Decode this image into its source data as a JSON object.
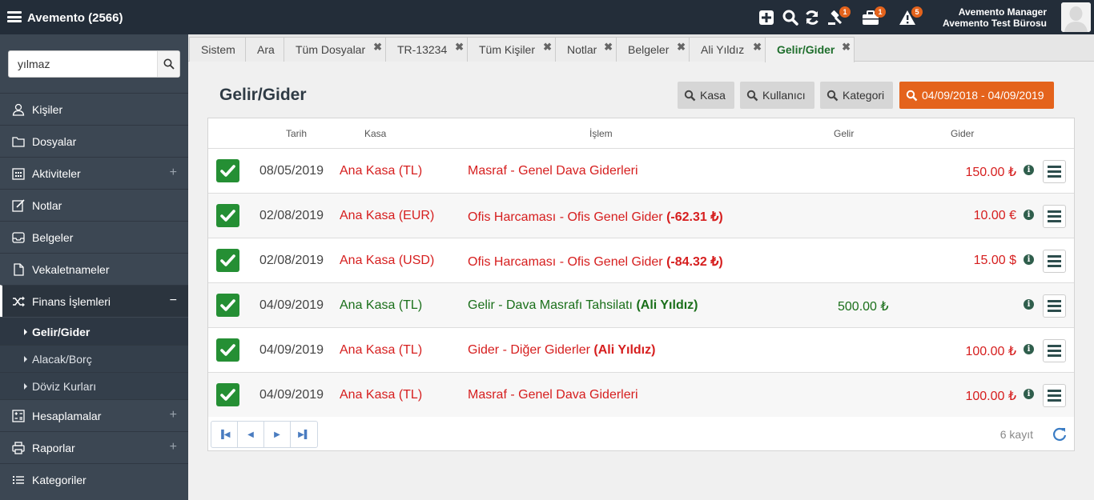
{
  "app": {
    "title": "Avemento (2566)"
  },
  "topbar": {
    "badges": {
      "gavel": "1",
      "briefcase": "1",
      "alert": "5"
    },
    "user_line1": "Avemento Manager",
    "user_line2": "Avemento Test Bürosu"
  },
  "sidebar": {
    "search_value": "yılmaz",
    "items": [
      {
        "label": "Kişiler",
        "icon": "person-icon",
        "plus": ""
      },
      {
        "label": "Dosyalar",
        "icon": "folder-icon",
        "plus": ""
      },
      {
        "label": "Aktiviteler",
        "icon": "calendar-icon",
        "plus": "+"
      },
      {
        "label": "Notlar",
        "icon": "edit-icon",
        "plus": ""
      },
      {
        "label": "Belgeler",
        "icon": "inbox-icon",
        "plus": ""
      },
      {
        "label": "Vekaletnameler",
        "icon": "file-icon",
        "plus": ""
      },
      {
        "label": "Finans İşlemleri",
        "icon": "shuffle-icon",
        "plus": "−"
      },
      {
        "label": "Hesaplamalar",
        "icon": "calculator-icon",
        "plus": "+"
      },
      {
        "label": "Raporlar",
        "icon": "printer-icon",
        "plus": "+"
      },
      {
        "label": "Kategoriler",
        "icon": "list-icon",
        "plus": ""
      }
    ],
    "submenu": [
      "Gelir/Gider",
      "Alacak/Borç",
      "Döviz Kurları"
    ]
  },
  "tabs": [
    {
      "label": "Sistem",
      "closable": false
    },
    {
      "label": "Ara",
      "closable": false
    },
    {
      "label": "Tüm Dosyalar",
      "closable": true
    },
    {
      "label": "TR-13234",
      "closable": true
    },
    {
      "label": "Tüm Kişiler",
      "closable": true
    },
    {
      "label": "Notlar",
      "closable": true
    },
    {
      "label": "Belgeler",
      "closable": true
    },
    {
      "label": "Ali Yıldız",
      "closable": true
    },
    {
      "label": "Gelir/Gider",
      "closable": true
    }
  ],
  "page": {
    "title": "Gelir/Gider"
  },
  "filters": {
    "kasa": "Kasa",
    "kullanici": "Kullanıcı",
    "kategori": "Kategori",
    "date_range": "04/09/2018 - 04/09/2019"
  },
  "table": {
    "headers": {
      "tarih": "Tarih",
      "kasa": "Kasa",
      "islem": "İşlem",
      "gelir": "Gelir",
      "gider": "Gider"
    },
    "rows": [
      {
        "date": "08/05/2019",
        "kasa": "Ana Kasa (TL)",
        "islem": "Masraf - Genel Dava Giderleri",
        "extra": "",
        "gelir": "",
        "gider": "150.00 ₺",
        "type": "gider"
      },
      {
        "date": "02/08/2019",
        "kasa": "Ana Kasa (EUR)",
        "islem": "Ofis Harcaması - Ofis Genel Gider",
        "extra": "(-62.31 ₺)",
        "gelir": "",
        "gider": "10.00 €",
        "type": "gider"
      },
      {
        "date": "02/08/2019",
        "kasa": "Ana Kasa (USD)",
        "islem": "Ofis Harcaması - Ofis Genel Gider",
        "extra": "(-84.32 ₺)",
        "gelir": "",
        "gider": "15.00 $",
        "type": "gider"
      },
      {
        "date": "04/09/2019",
        "kasa": "Ana Kasa (TL)",
        "islem": "Gelir - Dava Masrafı Tahsilatı",
        "extra": "(Ali Yıldız)",
        "gelir": "500.00 ₺",
        "gider": "",
        "type": "gelir"
      },
      {
        "date": "04/09/2019",
        "kasa": "Ana Kasa (TL)",
        "islem": "Gider - Diğer Giderler",
        "extra": "(Ali Yıldız)",
        "gelir": "",
        "gider": "100.00 ₺",
        "type": "gider"
      },
      {
        "date": "04/09/2019",
        "kasa": "Ana Kasa (TL)",
        "islem": "Masraf - Genel Dava Giderleri",
        "extra": "",
        "gelir": "",
        "gider": "100.00 ₺",
        "type": "gider"
      }
    ],
    "record_count": "6 kayıt"
  },
  "colors": {
    "topbar": "#232d39",
    "sidebar": "#3c4753",
    "accent_orange": "#e4631c",
    "check_green": "#258f34",
    "gider_red": "#d61e1e",
    "gelir_green": "#1a6f1a"
  }
}
